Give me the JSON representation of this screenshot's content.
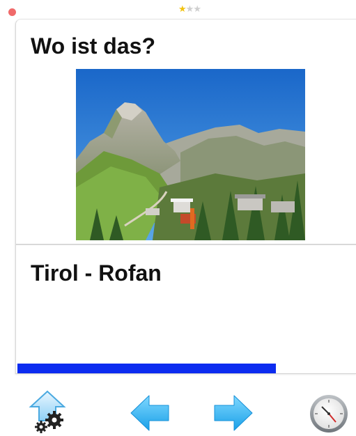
{
  "rating": {
    "filled": 1,
    "total": 3,
    "filled_color": "#f2c30f",
    "empty_color": "#cfcfcf"
  },
  "card": {
    "question": "Wo ist das?",
    "answer": "Tirol - Rofan",
    "image_icon": "mountain-landscape-photo"
  },
  "progress": {
    "fraction": 0.765,
    "color": "#0c2cf0"
  },
  "toolbar": {
    "settings_icon": "settings-gear-icon",
    "prev_icon": "arrow-left-icon",
    "next_icon": "arrow-right-icon",
    "clock_icon": "clock-icon"
  }
}
